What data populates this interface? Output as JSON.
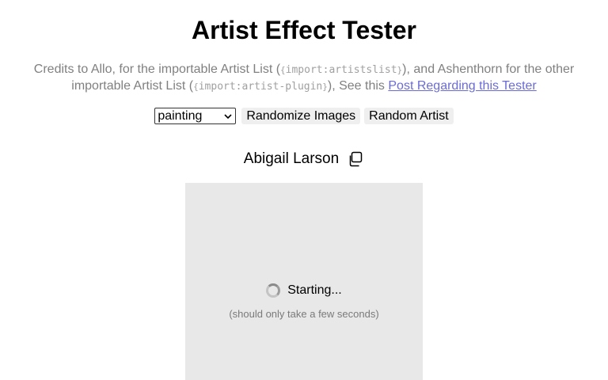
{
  "header": {
    "title": "Artist Effect Tester"
  },
  "credits": {
    "part1": "Credits to Allo, for the importable Artist List (",
    "code1_open": "{",
    "code1_text": "import:artistslist",
    "code1_close": "}",
    "part2": "), and Ashenthorn for the other importable Artist List (",
    "code2_open": "{",
    "code2_text": "import:artist-plugin",
    "code2_close": "}",
    "part3": "), See this ",
    "link_text": "Post Regarding this Tester"
  },
  "controls": {
    "style_select_value": "painting",
    "randomize_label": "Randomize Images",
    "random_artist_label": "Random Artist"
  },
  "artist": {
    "name": "Abigail Larson",
    "copy_icon": "copy-icon"
  },
  "image_panel": {
    "status": "Starting...",
    "substatus": "(should only take a few seconds)"
  },
  "colors": {
    "link": "#6b6bd6",
    "muted_text": "#808080",
    "panel_bg": "#e8e8e8",
    "button_bg": "#efefef"
  }
}
